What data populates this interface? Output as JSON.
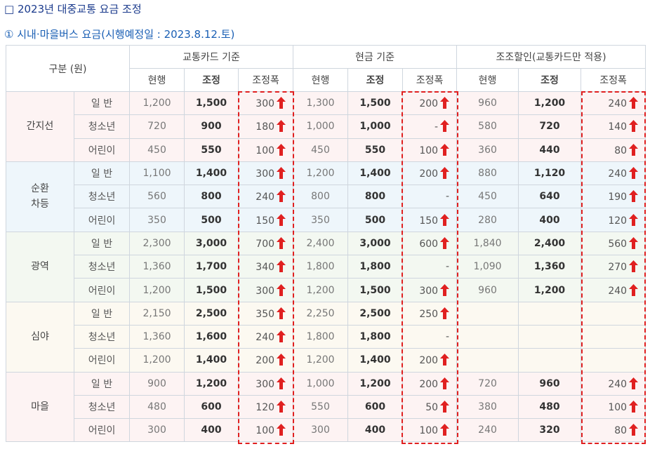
{
  "title": "□ 2023년 대중교통 요금 조정",
  "subtitle": "① 시내·마을버스 요금(시행예정일 : 2023.8.12.토)",
  "header": {
    "category": "구분 (원)",
    "groups": [
      "교통카드 기준",
      "현금 기준",
      "조조할인(교통카드만 적용)"
    ],
    "cols": [
      "현행",
      "조정",
      "조정폭"
    ]
  },
  "colors": {
    "accent": "#1a3a8c",
    "arrow": "#e02020",
    "highlight": "#e02020"
  },
  "rows": [
    {
      "group": "간지선",
      "sub": "일 반",
      "card": [
        "1,200",
        "1,500",
        "300"
      ],
      "cardUp": true,
      "cash": [
        "1,300",
        "1,500",
        "200"
      ],
      "cashUp": true,
      "early": [
        "960",
        "1,200",
        "240"
      ],
      "earlyUp": true
    },
    {
      "group": "",
      "sub": "청소년",
      "card": [
        "720",
        "900",
        "180"
      ],
      "cardUp": true,
      "cash": [
        "1,000",
        "1,000",
        "-"
      ],
      "cashUp": true,
      "early": [
        "580",
        "720",
        "140"
      ],
      "earlyUp": true
    },
    {
      "group": "",
      "sub": "어린이",
      "card": [
        "450",
        "550",
        "100"
      ],
      "cardUp": true,
      "cash": [
        "450",
        "550",
        "100"
      ],
      "cashUp": true,
      "early": [
        "360",
        "440",
        "80"
      ],
      "earlyUp": true
    },
    {
      "group": "순환\n차등",
      "sub": "일 반",
      "card": [
        "1,100",
        "1,400",
        "300"
      ],
      "cardUp": true,
      "cash": [
        "1,200",
        "1,400",
        "200"
      ],
      "cashUp": true,
      "early": [
        "880",
        "1,120",
        "240"
      ],
      "earlyUp": true
    },
    {
      "group": "",
      "sub": "청소년",
      "card": [
        "560",
        "800",
        "240"
      ],
      "cardUp": true,
      "cash": [
        "800",
        "800",
        "-"
      ],
      "cashUp": false,
      "early": [
        "450",
        "640",
        "190"
      ],
      "earlyUp": true
    },
    {
      "group": "",
      "sub": "어린이",
      "card": [
        "350",
        "500",
        "150"
      ],
      "cardUp": true,
      "cash": [
        "350",
        "500",
        "150"
      ],
      "cashUp": true,
      "early": [
        "280",
        "400",
        "120"
      ],
      "earlyUp": true
    },
    {
      "group": "광역",
      "sub": "일 반",
      "card": [
        "2,300",
        "3,000",
        "700"
      ],
      "cardUp": true,
      "cash": [
        "2,400",
        "3,000",
        "600"
      ],
      "cashUp": true,
      "early": [
        "1,840",
        "2,400",
        "560"
      ],
      "earlyUp": true
    },
    {
      "group": "",
      "sub": "청소년",
      "card": [
        "1,360",
        "1,700",
        "340"
      ],
      "cardUp": true,
      "cash": [
        "1,800",
        "1,800",
        "-"
      ],
      "cashUp": false,
      "early": [
        "1,090",
        "1,360",
        "270"
      ],
      "earlyUp": true
    },
    {
      "group": "",
      "sub": "어린이",
      "card": [
        "1,200",
        "1,500",
        "300"
      ],
      "cardUp": true,
      "cash": [
        "1,200",
        "1,500",
        "300"
      ],
      "cashUp": true,
      "early": [
        "960",
        "1,200",
        "240"
      ],
      "earlyUp": true
    },
    {
      "group": "심야",
      "sub": "일 반",
      "card": [
        "2,150",
        "2,500",
        "350"
      ],
      "cardUp": true,
      "cash": [
        "2,250",
        "2,500",
        "250"
      ],
      "cashUp": true,
      "early": [
        "",
        "",
        ""
      ],
      "earlyUp": false
    },
    {
      "group": "",
      "sub": "청소년",
      "card": [
        "1,360",
        "1,600",
        "240"
      ],
      "cardUp": true,
      "cash": [
        "1,800",
        "1,800",
        "-"
      ],
      "cashUp": false,
      "early": [
        "",
        "",
        ""
      ],
      "earlyUp": false
    },
    {
      "group": "",
      "sub": "어린이",
      "card": [
        "1,200",
        "1,400",
        "200"
      ],
      "cardUp": true,
      "cash": [
        "1,200",
        "1,400",
        "200"
      ],
      "cashUp": true,
      "early": [
        "",
        "",
        ""
      ],
      "earlyUp": false
    },
    {
      "group": "마을",
      "sub": "일 반",
      "card": [
        "900",
        "1,200",
        "300"
      ],
      "cardUp": true,
      "cash": [
        "1,000",
        "1,200",
        "200"
      ],
      "cashUp": true,
      "early": [
        "720",
        "960",
        "240"
      ],
      "earlyUp": true
    },
    {
      "group": "",
      "sub": "청소년",
      "card": [
        "480",
        "600",
        "120"
      ],
      "cardUp": true,
      "cash": [
        "550",
        "600",
        "50"
      ],
      "cashUp": true,
      "early": [
        "380",
        "480",
        "100"
      ],
      "earlyUp": true
    },
    {
      "group": "",
      "sub": "어린이",
      "card": [
        "300",
        "400",
        "100"
      ],
      "cardUp": true,
      "cash": [
        "300",
        "400",
        "100"
      ],
      "cashUp": true,
      "early": [
        "240",
        "320",
        "80"
      ],
      "earlyUp": true
    }
  ],
  "arrow_icon": "red-up-arrow-icon"
}
